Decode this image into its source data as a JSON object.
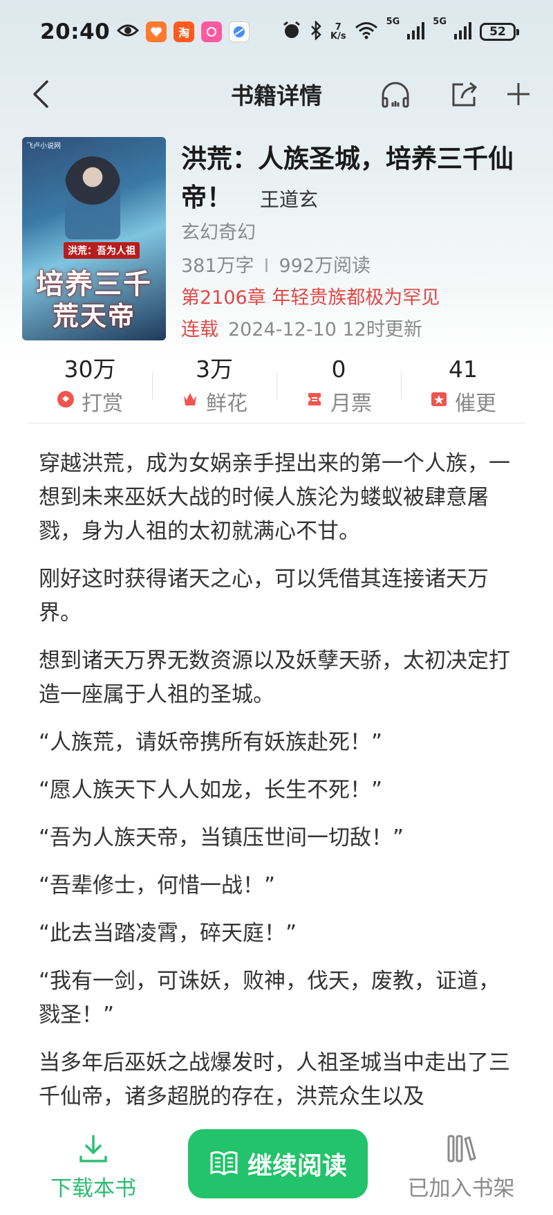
{
  "status_bar": {
    "time": "20:40",
    "net_speed_value": "7",
    "net_speed_unit": "K/s",
    "signal1_label": "5G",
    "signal2_label": "5G",
    "battery": "52",
    "notif_taobao_text": "淘"
  },
  "nav": {
    "title": "书籍详情"
  },
  "book": {
    "title": "洪荒：人族圣城，培养三千仙帝！",
    "author": "王道玄",
    "genre": "玄幻奇幻",
    "word_count": "381万字",
    "reads": "992万阅读",
    "latest_chapter": "第2106章 年轻贵族都极为罕见",
    "status": "连载",
    "updated": "2024-12-10 12时更新",
    "cover": {
      "site_logo": "飞卢小说网",
      "banner": "洪荒：吾为人祖",
      "title_line1": "培养三千",
      "title_line2": "荒天帝"
    }
  },
  "stats": [
    {
      "value": "30万",
      "label": "打赏",
      "icon": "reward-icon"
    },
    {
      "value": "3万",
      "label": "鲜花",
      "icon": "flower-icon"
    },
    {
      "value": "0",
      "label": "月票",
      "icon": "ticket-icon"
    },
    {
      "value": "41",
      "label": "催更",
      "icon": "urge-update-icon"
    }
  ],
  "synopsis": [
    "穿越洪荒，成为女娲亲手捏出来的第一个人族，一想到未来巫妖大战的时候人族沦为蝼蚁被肆意屠戮，身为人祖的太初就满心不甘。",
    "刚好这时获得诸天之心，可以凭借其连接诸天万界。",
    "想到诸天万界无数资源以及妖孽天骄，太初决定打造一座属于人祖的圣城。",
    "“人族荒，请妖帝携所有妖族赴死！”",
    "“愿人族天下人人如龙，长生不死！”",
    "“吾为人族天帝，当镇压世间一切敌！”",
    "“吾辈修士，何惜一战！”",
    "“此去当踏凌霄，碎天庭！”",
    "“我有一剑，可诛妖，败神，伐天，废教，证道，戮圣！”",
    "当多年后巫妖之战爆发时，人祖圣城当中走出了三千仙帝，诸多超脱的存在，洪荒众生以及"
  ],
  "bottom": {
    "download_label": "下载本书",
    "read_label": "继续阅读",
    "shelf_label": "已加入书架"
  },
  "colors": {
    "accent_green": "#22c36a",
    "accent_red": "#e04848"
  }
}
